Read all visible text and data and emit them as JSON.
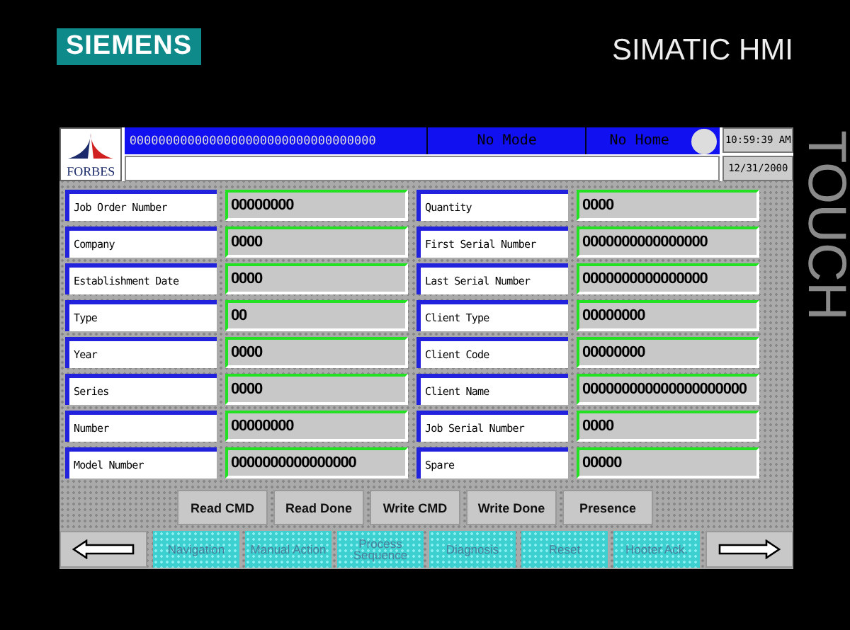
{
  "brand": {
    "logo": "SIEMENS",
    "product": "SIMATIC HMI",
    "side_label": "TOUCH"
  },
  "header": {
    "company_logo": "FORBES",
    "status_code": "0000000000000000000000000000000000",
    "mode": "No Mode",
    "home": "No Home",
    "time": "10:59:39 AM",
    "date": "12/31/2000"
  },
  "fields": [
    {
      "label": "Job Order Number",
      "value": "00000000"
    },
    {
      "label": "Quantity",
      "value": "0000"
    },
    {
      "label": "Company",
      "value": "0000"
    },
    {
      "label": "First Serial Number",
      "value": "0000000000000000"
    },
    {
      "label": "Establishment Date",
      "value": "0000"
    },
    {
      "label": "Last Serial Number",
      "value": "0000000000000000"
    },
    {
      "label": "Type",
      "value": "00"
    },
    {
      "label": "Client Type",
      "value": "00000000"
    },
    {
      "label": "Year",
      "value": "0000"
    },
    {
      "label": "Client Code",
      "value": "00000000"
    },
    {
      "label": "Series",
      "value": "0000"
    },
    {
      "label": "Client Name",
      "value": "000000000000000000000"
    },
    {
      "label": "Number",
      "value": "00000000"
    },
    {
      "label": "Job Serial Number",
      "value": "0000"
    },
    {
      "label": "Model Number",
      "value": "0000000000000000"
    },
    {
      "label": "Spare",
      "value": "00000"
    }
  ],
  "commands": [
    "Read CMD",
    "Read Done",
    "Write CMD",
    "Write Done",
    "Presence"
  ],
  "nav": [
    {
      "kind": "back"
    },
    {
      "kind": "function",
      "label": "Navigation"
    },
    {
      "kind": "function",
      "label": "Manual Action"
    },
    {
      "kind": "function",
      "label": "Process Sequence"
    },
    {
      "kind": "function",
      "label": "Diagnosis"
    },
    {
      "kind": "function",
      "label": "Reset"
    },
    {
      "kind": "function",
      "label": "Hooter Ack."
    },
    {
      "kind": "forward"
    }
  ]
}
